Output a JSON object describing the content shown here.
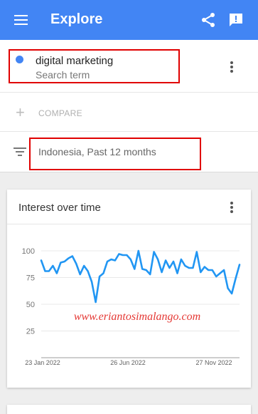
{
  "appbar": {
    "title": "Explore",
    "menu_icon": "hamburger-menu-icon",
    "share_icon": "share-icon",
    "feedback_icon": "feedback-icon",
    "background": "#4285f4"
  },
  "search": {
    "term": "digital marketing",
    "term_type": "Search term",
    "dot_color": "#4285f4",
    "compare_label": "COMPARE",
    "filter_text": "Indonesia, Past 12 months"
  },
  "card": {
    "title": "Interest over time",
    "watermark": "www.eriantosimalango.com"
  },
  "chart_data": {
    "type": "line",
    "x_labels": [
      "23 Jan 2022",
      "26 Jun 2022",
      "27 Nov 2022"
    ],
    "ylim": [
      0,
      100
    ],
    "y_ticks": [
      100,
      75,
      50,
      25
    ],
    "grid": true,
    "series": [
      {
        "color": "#2196f3",
        "values": [
          91,
          81,
          81,
          86,
          79,
          89,
          90,
          93,
          95,
          88,
          78,
          86,
          81,
          71,
          52,
          76,
          79,
          90,
          92,
          91,
          97,
          96,
          96,
          92,
          83,
          100,
          83,
          82,
          78,
          99,
          92,
          80,
          91,
          84,
          90,
          79,
          92,
          86,
          84,
          84,
          99,
          80,
          85,
          82,
          82,
          76,
          79,
          82,
          65,
          60,
          74,
          87
        ]
      }
    ]
  }
}
